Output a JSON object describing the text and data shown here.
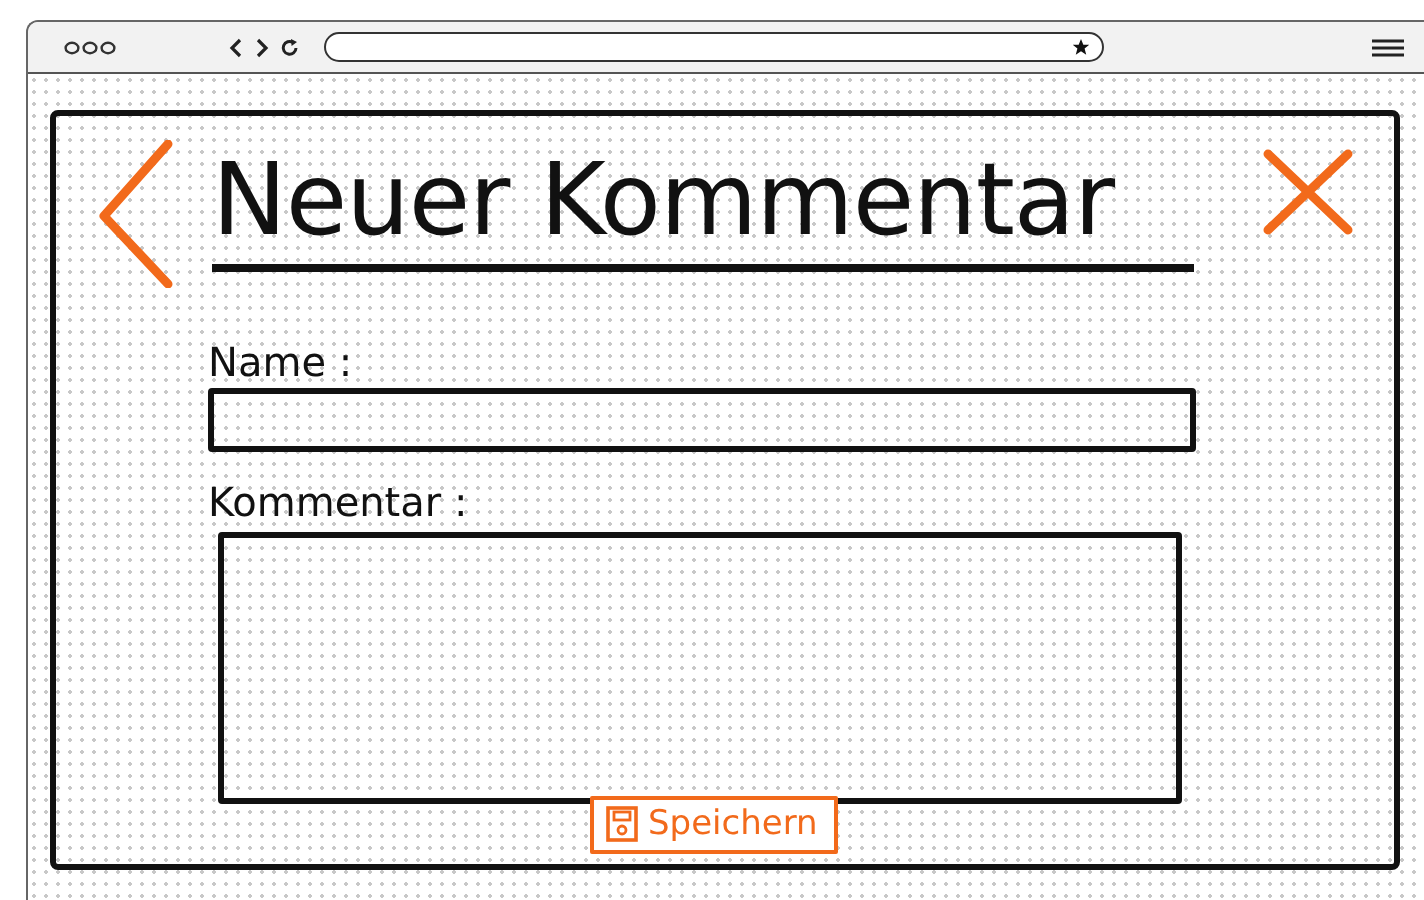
{
  "title": "Neuer Kommentar",
  "fields": [
    {
      "kind": "line",
      "label": "Name :"
    },
    {
      "kind": "area",
      "label": "Kommentar :"
    }
  ],
  "save_button": {
    "label": "Speichern"
  }
}
